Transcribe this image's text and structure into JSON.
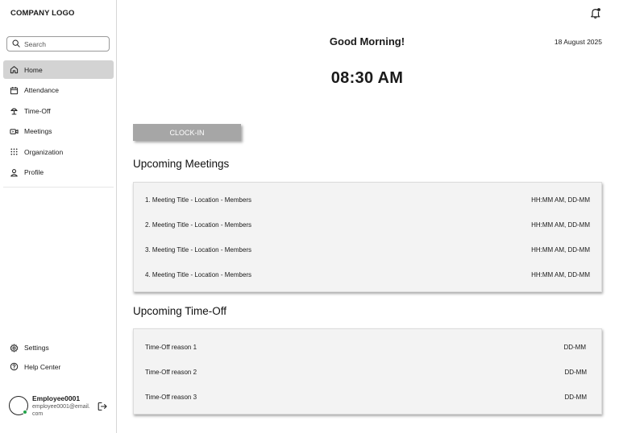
{
  "sidebar": {
    "logo": "COMPANY LOGO",
    "search_placeholder": "Search",
    "items": [
      {
        "label": "Home",
        "icon": "home-icon"
      },
      {
        "label": "Attendance",
        "icon": "calendar-icon"
      },
      {
        "label": "Time-Off",
        "icon": "beach-umbrella-icon"
      },
      {
        "label": "Meetings",
        "icon": "video-camera-icon"
      },
      {
        "label": "Organization",
        "icon": "grid-icon"
      },
      {
        "label": "Profile",
        "icon": "user-icon"
      }
    ],
    "active_item": "Home",
    "bottom_items": [
      {
        "label": "Settings",
        "icon": "gear-icon"
      },
      {
        "label": "Help Center",
        "icon": "help-circle-icon"
      }
    ],
    "profile": {
      "name": "Employee0001",
      "email": "employee0001@email.com",
      "status_color": "#22a34a"
    }
  },
  "header": {
    "greeting": "Good Morning!",
    "date": "18 August 2025",
    "time": "08:30 AM"
  },
  "clock_in": {
    "label": "CLOCK-IN"
  },
  "meetings": {
    "title": "Upcoming Meetings",
    "items": [
      {
        "text": "1. Meeting Title - Location - Members",
        "when": "HH:MM AM, DD-MM"
      },
      {
        "text": "2. Meeting Title - Location - Members",
        "when": "HH:MM AM, DD-MM"
      },
      {
        "text": "3. Meeting Title - Location - Members",
        "when": "HH:MM AM, DD-MM"
      },
      {
        "text": "4. Meeting Title - Location - Members",
        "when": "HH:MM AM, DD-MM"
      }
    ]
  },
  "timeoff": {
    "title": "Upcoming Time-Off",
    "items": [
      {
        "text": "Time-Off reason 1",
        "when": "DD-MM"
      },
      {
        "text": "Time-Off reason 2",
        "when": "DD-MM"
      },
      {
        "text": "Time-Off reason 3",
        "when": "DD-MM"
      }
    ]
  }
}
